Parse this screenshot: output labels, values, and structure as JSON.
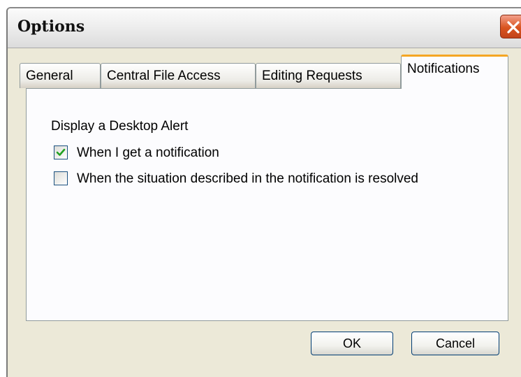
{
  "window": {
    "title": "Options"
  },
  "tabs": [
    {
      "label": "General"
    },
    {
      "label": "Central File Access"
    },
    {
      "label": "Editing Requests"
    },
    {
      "label": "Notifications",
      "active": true
    }
  ],
  "notifications": {
    "section_label": "Display a Desktop Alert",
    "options": [
      {
        "label": "When I get a notification",
        "checked": true
      },
      {
        "label": "When the situation described in the notification is resolved",
        "checked": false
      }
    ]
  },
  "buttons": {
    "ok": "OK",
    "cancel": "Cancel"
  },
  "colors": {
    "close_button": "#d9541f",
    "active_tab_accent": "#f5a623",
    "check_mark": "#21a121"
  }
}
